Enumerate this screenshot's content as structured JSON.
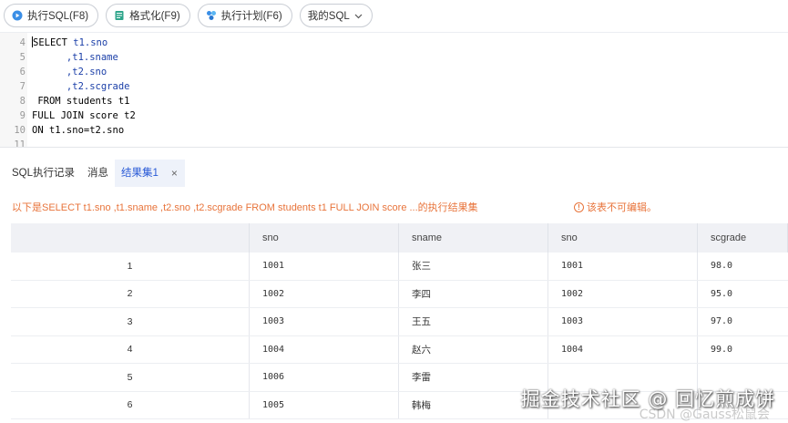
{
  "toolbar": {
    "run_sql": "执行SQL(F8)",
    "format": "格式化(F9)",
    "explain": "执行计划(F6)",
    "my_sql": "我的SQL"
  },
  "editor": {
    "lines": [
      {
        "num": "4",
        "text": "SELECT t1.sno"
      },
      {
        "num": "5",
        "text": "      ,t1.sname"
      },
      {
        "num": "6",
        "text": "      ,t2.sno"
      },
      {
        "num": "7",
        "text": "      ,t2.scgrade"
      },
      {
        "num": "8",
        "text": " FROM students t1"
      },
      {
        "num": "9",
        "text": "FULL JOIN score t2"
      },
      {
        "num": "10",
        "text": "ON t1.sno=t2.sno"
      },
      {
        "num": "11",
        "text": ""
      }
    ]
  },
  "tabs": {
    "history": "SQL执行记录",
    "messages": "消息",
    "result": "结果集1",
    "close": "×"
  },
  "notice": {
    "message": "以下是SELECT t1.sno ,t1.sname ,t2.sno ,t2.scgrade FROM students t1 FULL JOIN score ...的执行结果集",
    "readonly": "该表不可编辑。"
  },
  "grid": {
    "columns": [
      "",
      "sno",
      "sname",
      "sno",
      "scgrade"
    ],
    "rows": [
      [
        "1",
        "1001",
        "张三",
        "1001",
        "98.0"
      ],
      [
        "2",
        "1002",
        "李四",
        "1002",
        "95.0"
      ],
      [
        "3",
        "1003",
        "王五",
        "1003",
        "97.0"
      ],
      [
        "4",
        "1004",
        "赵六",
        "1004",
        "99.0"
      ],
      [
        "5",
        "1006",
        "李雷",
        "",
        ""
      ],
      [
        "6",
        "1005",
        "韩梅",
        "",
        ""
      ]
    ]
  },
  "watermark": {
    "main": "掘金技术社区 @ 回忆煎成饼",
    "sub": "CSDN @Gauss松鼠会"
  },
  "colors": {
    "accent": "#2a5bd7",
    "notice": "#e8743b"
  }
}
